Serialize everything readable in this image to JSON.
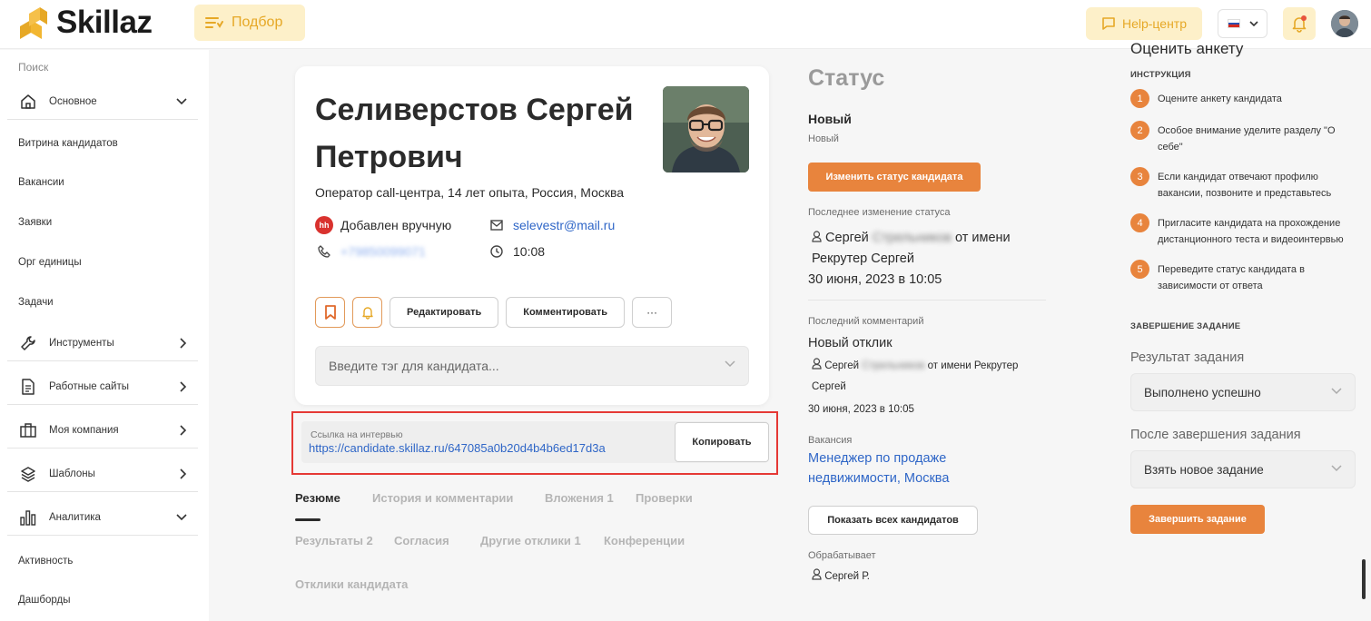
{
  "header": {
    "logo_text": "Skillaz",
    "podbor_label": "Подбор",
    "help_label": "Help-центр"
  },
  "sidebar": {
    "search_label": "Поиск",
    "groups": {
      "osnovnoe": "Основное",
      "instrumenty": "Инструменты",
      "rabochie_saity": "Работные сайты",
      "moya_kompaniya": "Моя компания",
      "shablony": "Шаблоны",
      "analitika": "Аналитика"
    },
    "items": {
      "vitrina": "Витрина кандидатов",
      "vakansii": "Вакансии",
      "zayavki": "Заявки",
      "org": "Орг единицы",
      "zadachi": "Задачи",
      "aktivnost": "Активность",
      "dashbordy": "Дашборды"
    }
  },
  "candidate": {
    "name_line1": "Селиверстов Сергей",
    "name_line2": "Петрович",
    "subtitle": "Оператор call-центра, 14 лет опыта, Россия, Москва",
    "source_badge": "hh",
    "source": "Добавлен вручную",
    "email": "selevestr@mail.ru",
    "phone": "+79850099071",
    "time": "10:08",
    "edit_label": "Редактировать",
    "comment_label": "Комментировать",
    "more_label": "···",
    "tag_placeholder": "Введите тэг для кандидата..."
  },
  "interview": {
    "caption": "Ссылка на интервью",
    "url": "https://candidate.skillaz.ru/647085a0b20d4b4b6ed17d3a",
    "copy_label": "Копировать"
  },
  "tabs": {
    "resume": "Резюме",
    "history": "История и комментарии",
    "attachments": "Вложения 1",
    "checks": "Проверки",
    "results": "Результаты 2",
    "consents": "Согласия",
    "other_responses": "Другие отклики 1",
    "conferences": "Конференции",
    "candidate_responses": "Отклики кандидата"
  },
  "status": {
    "title": "Статус",
    "current": "Новый",
    "current_sub": "Новый",
    "change_button": "Изменить статус кандидата",
    "last_change_caption": "Последнее изменение статуса",
    "changer_first": "Сергей",
    "changer_last": "Стрельников",
    "changer_suffix": "от имени",
    "changer_line2": "Рекрутер Сергей",
    "change_date": "30 июня, 2023 в 10:05",
    "last_comment_caption": "Последний комментарий",
    "last_comment": "Новый отклик",
    "commenter_first": "Сергей",
    "commenter_last": "Стрельников",
    "commenter_suffix": "от имени Рекрутер",
    "commenter_line2": "Сергей",
    "comment_date": "30 июня, 2023 в 10:05",
    "vacancy_caption": "Вакансия",
    "vacancy_line1": "Менеджер по продаже",
    "vacancy_line2": "недвижимости, Москва",
    "show_all_button": "Показать всех кандидатов",
    "handler_caption": "Обрабатывает",
    "handler": "Сергей Р."
  },
  "instructions": {
    "heading": "Оценить анкету",
    "caption": "ИНСТРУКЦИЯ",
    "steps": [
      {
        "num": "1",
        "line1": "Оцените анкету кандидата",
        "line2": ""
      },
      {
        "num": "2",
        "line1": "Особое внимание уделите разделу \"О",
        "line2": "себе\""
      },
      {
        "num": "3",
        "line1": "Если кандидат отвечают профилю",
        "line2": "вакансии, позвоните и представьтесь"
      },
      {
        "num": "4",
        "line1": "Пригласите кандидата на прохождение",
        "line2": "дистанционного теста и видеоинтервью"
      },
      {
        "num": "5",
        "line1": "Переведите статус кандидата в",
        "line2": "зависимости от ответа"
      }
    ],
    "finish_caption": "ЗАВЕРШЕНИЕ ЗАДАНИЕ",
    "result_label": "Результат задания",
    "result_value": "Выполнено успешно",
    "after_label": "После завершения задания",
    "after_value": "Взять новое задание",
    "finish_button": "Завершить задание"
  },
  "colors": {
    "accent_orange": "#e8843d",
    "link_blue": "#2f66c7",
    "highlight_red": "#e53935",
    "header_yellow": "#fdf0c9"
  }
}
